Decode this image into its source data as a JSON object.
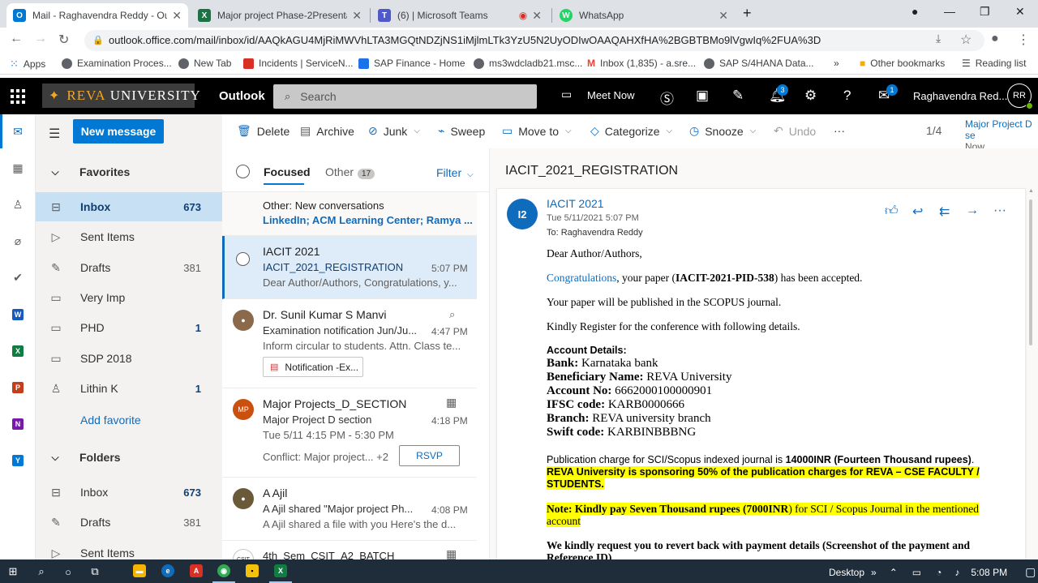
{
  "browser": {
    "tabs": [
      {
        "title": "Mail - Raghavendra Reddy - Outl",
        "icon": "outlook-icon",
        "color": "#0078d4"
      },
      {
        "title": "Major project Phase-2Presentatio",
        "icon": "excel-icon",
        "color": "#1e7145"
      },
      {
        "title": "(6) | Microsoft Teams",
        "icon": "teams-icon",
        "color": "#5059c9"
      },
      {
        "title": "WhatsApp",
        "icon": "whatsapp-icon",
        "color": "#25d366"
      }
    ],
    "url": "outlook.office.com/mail/inbox/id/AAQkAGU4MjRiMWVhLTA3MGQtNDZjNS1iMjlmLTk3YzU5N2UyODIwOAAQAHXfHA%2BGBTBMo9lVgwIq%2FUA%3D",
    "bookmarks": [
      {
        "label": "Apps",
        "icon": "apps-grid-icon"
      },
      {
        "label": "Examination Proces...",
        "icon": "globe-icon"
      },
      {
        "label": "New Tab",
        "icon": "globe-icon"
      },
      {
        "label": "Incidents | ServiceN...",
        "icon": "servicenow-icon"
      },
      {
        "label": "SAP Finance - Home",
        "icon": "sap-icon"
      },
      {
        "label": "ms3wdcladb21.msc...",
        "icon": "globe-icon"
      },
      {
        "label": "Inbox (1,835) - a.sre...",
        "icon": "gmail-icon"
      },
      {
        "label": "SAP S/4HANA Data...",
        "icon": "globe-icon"
      }
    ],
    "more_bookmarks": "»",
    "other_bookmarks": "Other bookmarks",
    "reading_list": "Reading list"
  },
  "header": {
    "org_name_1": "REVA",
    "org_name_2": "UNIVERSITY",
    "app_name": "Outlook",
    "search_placeholder": "Search",
    "meet_now": "Meet Now",
    "notifications_badge": "3",
    "feedback_badge": "1",
    "user_name": "Raghavendra Red...",
    "user_initials": "RR"
  },
  "folders": {
    "new_message": "New message",
    "favorites_label": "Favorites",
    "favorites": [
      {
        "label": "Inbox",
        "count": "673",
        "icon": "inbox-icon",
        "selected": true
      },
      {
        "label": "Sent Items",
        "count": "",
        "icon": "send-icon"
      },
      {
        "label": "Drafts",
        "count": "381",
        "icon": "pencil-icon"
      },
      {
        "label": "Very Imp",
        "count": "",
        "icon": "folder-icon"
      },
      {
        "label": "PHD",
        "count": "1",
        "icon": "folder-icon"
      },
      {
        "label": "SDP 2018",
        "count": "",
        "icon": "folder-icon"
      },
      {
        "label": "Lithin K",
        "count": "1",
        "icon": "person-icon"
      }
    ],
    "add_favorite": "Add favorite",
    "folders_label": "Folders",
    "folders": [
      {
        "label": "Inbox",
        "count": "673",
        "icon": "inbox-icon"
      },
      {
        "label": "Drafts",
        "count": "381",
        "icon": "pencil-icon"
      },
      {
        "label": "Sent Items",
        "count": "",
        "icon": "send-icon"
      }
    ]
  },
  "commands": {
    "delete": "Delete",
    "archive": "Archive",
    "junk": "Junk",
    "sweep": "Sweep",
    "move_to": "Move to",
    "categorize": "Categorize",
    "snooze": "Snooze",
    "undo": "Undo",
    "more": "···",
    "pager": "1/4",
    "peek_title": "Major Project D se",
    "peek_time": "Now"
  },
  "list": {
    "focused": "Focused",
    "other": "Other",
    "other_count": "17",
    "filter": "Filter",
    "other_banner_title": "Other: New conversations",
    "other_banner_senders": "LinkedIn; ACM Learning Center; Ramya ...",
    "messages": [
      {
        "sender": "IACIT 2021",
        "subject": "IACIT_2021_REGISTRATION",
        "time": "5:07 PM",
        "preview": "Dear Author/Authors, Congratulations, y...",
        "selected": true
      },
      {
        "sender": "Dr. Sunil Kumar S Manvi",
        "subject": "Examination notification Jun/Ju...",
        "time": "4:47 PM",
        "preview": "Inform circular to students. Attn. Class te...",
        "attachment": "Notification -Ex..."
      },
      {
        "sender": "Major Projects_D_SECTION",
        "subject": "Major Project D section",
        "time": "4:18 PM",
        "preview": "Tue 5/11 4:15 PM - 5:30 PM",
        "extra": "Conflict: Major project... +2",
        "rsvp": "RSVP",
        "initials": "MP"
      },
      {
        "sender": "A Ajil",
        "subject": "A Ajil shared \"Major project Ph...",
        "time": "4:08 PM",
        "preview": "A Ajil shared a file with you Here's the d..."
      },
      {
        "sender": "4th_Sem_CSIT_A2_BATCH",
        "subject": "",
        "time": "",
        "preview": ""
      }
    ]
  },
  "reading": {
    "subject": "IACIT_2021_REGISTRATION",
    "sender_initials": "I2",
    "from": "IACIT 2021",
    "date": "Tue 5/11/2021 5:07 PM",
    "to": "To:  Raghavendra Reddy",
    "greeting": "Dear Author/Authors,",
    "congrats_link": "Congratulations",
    "accepted_pre": ", your paper (",
    "paper_id": "IACIT-2021-PID-538",
    "accepted_post": ") has been accepted.",
    "published": "Your paper will be published in the SCOPUS journal.",
    "register": "Kindly Register for the conference with following details.",
    "account_details": "Account Details:",
    "bank_label": "Bank:",
    "bank": " Karnataka bank",
    "beneficiary_label": "Beneficiary Name:",
    "beneficiary": "  REVA University",
    "account_label": "Account No:",
    "account": " 6662000100000901",
    "ifsc_label": "IFSC code:",
    "ifsc": " KARB0000666",
    "branch_label": "Branch:",
    "branch": " REVA university branch",
    "swift_label": "Swift code:",
    "swift": " KARBINBBBNG",
    "pub_charge_pre": "Publication charge for SCI/Scopus indexed journal is ",
    "pub_charge_amt": "14000INR (Fourteen Thousand rupees)",
    "pub_charge_post": ".",
    "sponsor_1": "REVA University is sponsoring 50% of the publication charges for REVA – CSE FACULTY /",
    "sponsor_2": "STUDENTS.",
    "note_label": "Note:",
    "note_bold": "  Kindly pay Seven Thousand rupees (7000INR",
    "note_rest": ") for SCI / Scopus Journal in the mentioned",
    "note_2": "account",
    "revert_1": "We kindly request you to revert back with payment details (Screenshot of the payment and",
    "revert_2": "Reference ID)"
  },
  "taskbar": {
    "desktop": "Desktop",
    "more": "»",
    "time": "5:08 PM"
  }
}
